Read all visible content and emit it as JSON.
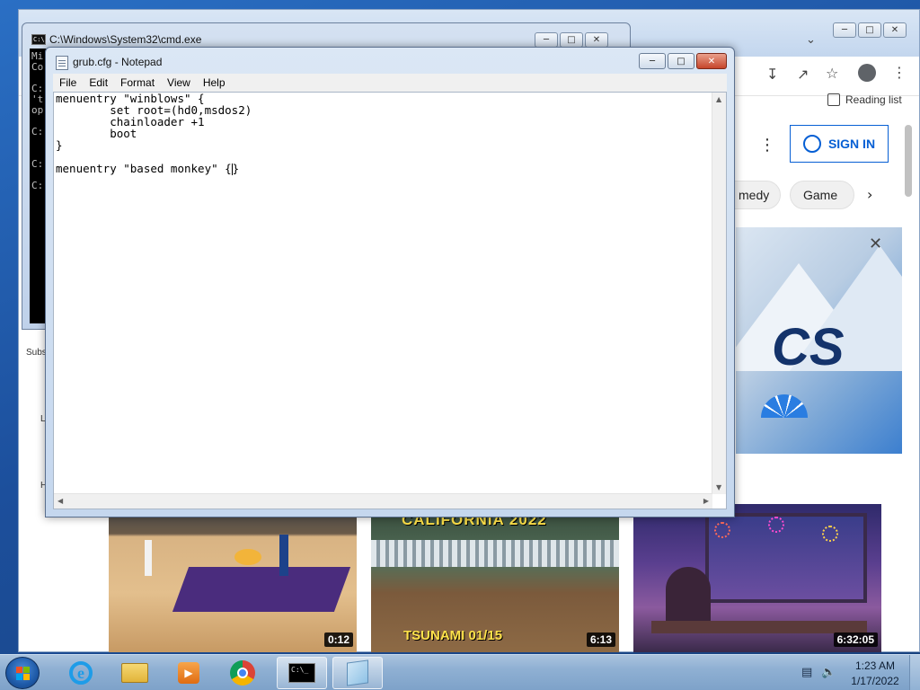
{
  "chrome": {
    "reading_list": "Reading list",
    "sign_in": "SIGN IN",
    "chips": [
      "medy",
      "Game"
    ],
    "side_labels": [
      "Subs",
      "L",
      "H"
    ],
    "banner_text": "CS",
    "videos": [
      {
        "duration": "0:12",
        "overlay_top": "",
        "overlay_bottom": ""
      },
      {
        "duration": "6:13",
        "overlay_top": "CALIFORNIA 2022",
        "overlay_bottom": "TSUNAMI 01/15"
      },
      {
        "duration": "6:32:05",
        "overlay_top": "",
        "overlay_bottom": ""
      }
    ]
  },
  "cmd": {
    "title": "C:\\Windows\\System32\\cmd.exe",
    "icon_text": "C:\\",
    "lines": [
      "Mi",
      "Co",
      "",
      "C:",
      "'t",
      "op",
      "",
      "C:",
      "",
      "",
      "C:",
      "",
      "C:"
    ]
  },
  "notepad": {
    "title": "grub.cfg - Notepad",
    "menu": [
      "File",
      "Edit",
      "Format",
      "View",
      "Help"
    ],
    "content": "menuentry \"winblows\" {\n        set root=(hd0,msdos2)\n        chainloader +1\n        boot\n}\n\nmenuentry \"based monkey\" {",
    "trailing": "}"
  },
  "taskbar": {
    "time": "1:23 AM",
    "date": "1/17/2022"
  }
}
